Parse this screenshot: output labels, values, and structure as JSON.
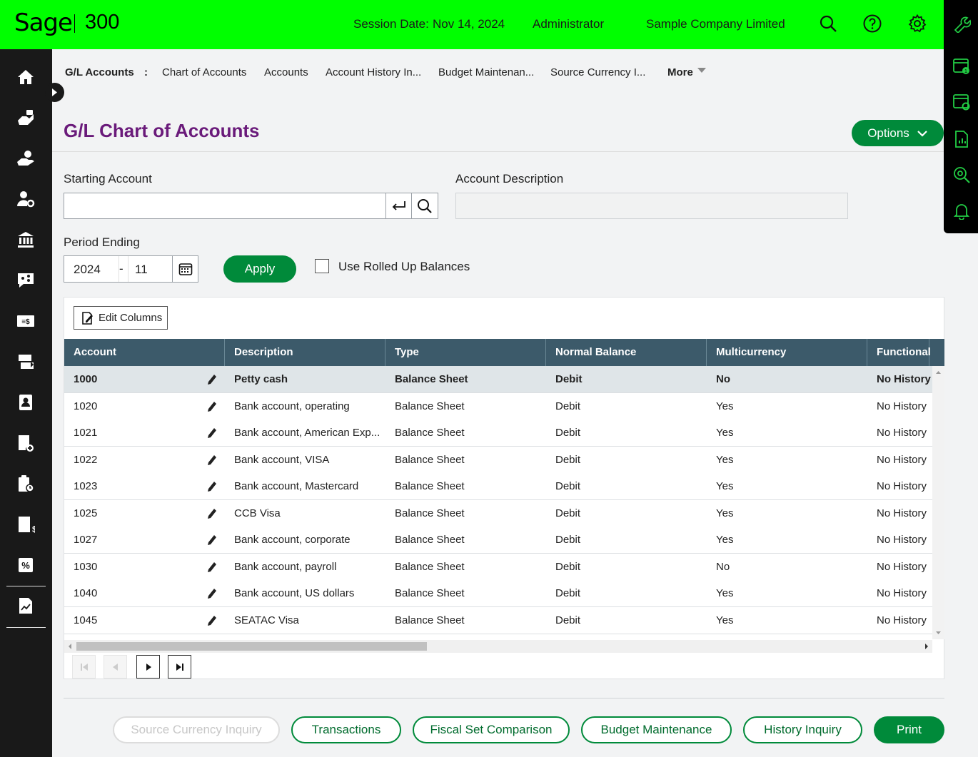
{
  "header": {
    "logo": "Sage",
    "product": "300",
    "session_label": "Session Date:",
    "session_date": "Nov 14, 2024",
    "user": "Administrator",
    "company": "Sample Company Limited",
    "accent_color": "#00ff00"
  },
  "breadcrumb": {
    "module": "G/L Accounts",
    "separator": ":",
    "items": [
      "Chart of Accounts",
      "Accounts",
      "Account History In...",
      "Budget Maintenan...",
      "Source Currency I..."
    ],
    "more": "More"
  },
  "page": {
    "title": "G/L Chart of Accounts",
    "options_label": "Options"
  },
  "form": {
    "starting_account_label": "Starting Account",
    "starting_account_value": "",
    "account_description_label": "Account Description",
    "account_description_value": "",
    "period_ending_label": "Period Ending",
    "period_year": "2024",
    "period_dash": "-",
    "period_month": "11",
    "apply_label": "Apply",
    "rolled_up_label": "Use Rolled Up Balances",
    "rolled_up_checked": false
  },
  "grid": {
    "edit_columns_label": "Edit Columns",
    "columns": [
      "Account",
      "Description",
      "Type",
      "Normal Balance",
      "Multicurrency",
      "Functional"
    ],
    "rows": [
      {
        "account": "1000",
        "description": "Petty cash",
        "type": "Balance Sheet",
        "normal": "Debit",
        "multi": "No",
        "functional": "No History"
      },
      {
        "account": "1020",
        "description": "Bank account, operating",
        "type": "Balance Sheet",
        "normal": "Debit",
        "multi": "Yes",
        "functional": "No History"
      },
      {
        "account": "1021",
        "description": "Bank account, American Exp...",
        "type": "Balance Sheet",
        "normal": "Debit",
        "multi": "Yes",
        "functional": "No History"
      },
      {
        "account": "1022",
        "description": "Bank account, VISA",
        "type": "Balance Sheet",
        "normal": "Debit",
        "multi": "Yes",
        "functional": "No History"
      },
      {
        "account": "1023",
        "description": "Bank account, Mastercard",
        "type": "Balance Sheet",
        "normal": "Debit",
        "multi": "Yes",
        "functional": "No History"
      },
      {
        "account": "1025",
        "description": "CCB Visa",
        "type": "Balance Sheet",
        "normal": "Debit",
        "multi": "Yes",
        "functional": "No History"
      },
      {
        "account": "1027",
        "description": "Bank account, corporate",
        "type": "Balance Sheet",
        "normal": "Debit",
        "multi": "Yes",
        "functional": "No History"
      },
      {
        "account": "1030",
        "description": "Bank account, payroll",
        "type": "Balance Sheet",
        "normal": "Debit",
        "multi": "No",
        "functional": "No History"
      },
      {
        "account": "1040",
        "description": "Bank account, US dollars",
        "type": "Balance Sheet",
        "normal": "Debit",
        "multi": "Yes",
        "functional": "No History"
      },
      {
        "account": "1045",
        "description": "SEATAC Visa",
        "type": "Balance Sheet",
        "normal": "Debit",
        "multi": "Yes",
        "functional": "No History"
      }
    ]
  },
  "footer_buttons": {
    "source_currency": "Source Currency Inquiry",
    "transactions": "Transactions",
    "fiscal_set": "Fiscal Set Comparison",
    "budget": "Budget Maintenance",
    "history": "History Inquiry",
    "print": "Print"
  }
}
